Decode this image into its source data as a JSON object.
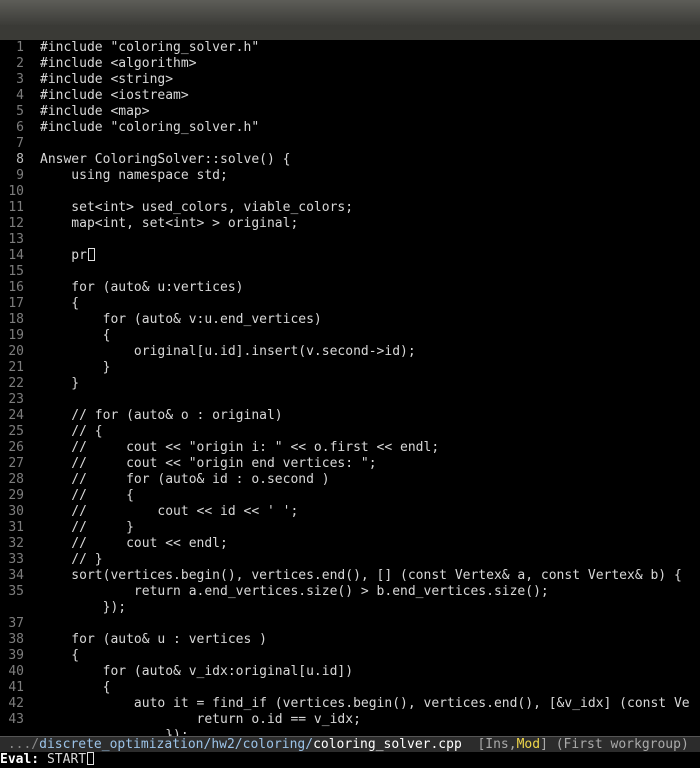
{
  "colors": {
    "background": "#000000",
    "text": "#d8d8d8",
    "line_number": "#7d7d7d",
    "modeline_modified": "#f0d64a",
    "modeline_path": "#9cc3e8"
  },
  "editor": {
    "lines": [
      {
        "num": "1",
        "text": "#include \"coloring_solver.h\""
      },
      {
        "num": "2",
        "text": "#include <algorithm>"
      },
      {
        "num": "3",
        "text": "#include <string>"
      },
      {
        "num": "4",
        "text": "#include <iostream>"
      },
      {
        "num": "5",
        "text": "#include <map>"
      },
      {
        "num": "6",
        "text": "#include \"coloring_solver.h\""
      },
      {
        "num": "7",
        "text": ""
      },
      {
        "num": "8",
        "text": "Answer ColoringSolver::solve() {"
      },
      {
        "num": "9",
        "text": "    using namespace std;"
      },
      {
        "num": "10",
        "text": ""
      },
      {
        "num": "11",
        "text": "    set<int> used_colors, viable_colors;"
      },
      {
        "num": "12",
        "text": "    map<int, set<int> > original;"
      },
      {
        "num": "13",
        "text": ""
      },
      {
        "num": "14",
        "text": "    pr"
      },
      {
        "num": "15",
        "text": ""
      },
      {
        "num": "16",
        "text": "    for (auto& u:vertices)"
      },
      {
        "num": "17",
        "text": "    {"
      },
      {
        "num": "18",
        "text": "        for (auto& v:u.end_vertices)"
      },
      {
        "num": "19",
        "text": "        {"
      },
      {
        "num": "20",
        "text": "            original[u.id].insert(v.second->id);"
      },
      {
        "num": "21",
        "text": "        }"
      },
      {
        "num": "22",
        "text": "    }"
      },
      {
        "num": "23",
        "text": ""
      },
      {
        "num": "24",
        "text": "    // for (auto& o : original)"
      },
      {
        "num": "25",
        "text": "    // {"
      },
      {
        "num": "26",
        "text": "    //     cout << \"origin i: \" << o.first << endl;"
      },
      {
        "num": "27",
        "text": "    //     cout << \"origin end vertices: \";"
      },
      {
        "num": "28",
        "text": "    //     for (auto& id : o.second )"
      },
      {
        "num": "29",
        "text": "    //     {"
      },
      {
        "num": "30",
        "text": "    //         cout << id << ' ';"
      },
      {
        "num": "31",
        "text": "    //     }"
      },
      {
        "num": "32",
        "text": "    //     cout << endl;"
      },
      {
        "num": "33",
        "text": "    // }"
      },
      {
        "num": "34",
        "text": "    sort(vertices.begin(), vertices.end(), [] (const Vertex& a, const Vertex& b) {"
      },
      {
        "num": "35",
        "text": "            return a.end_vertices.size() > b.end_vertices.size();"
      },
      {
        "num": "",
        "text": "        });"
      },
      {
        "num": "37",
        "text": ""
      },
      {
        "num": "38",
        "text": "    for (auto& u : vertices )"
      },
      {
        "num": "39",
        "text": "    {"
      },
      {
        "num": "40",
        "text": "        for (auto& v_idx:original[u.id])"
      },
      {
        "num": "41",
        "text": "        {"
      },
      {
        "num": "42",
        "text": "            auto it = find_if (vertices.begin(), vertices.end(), [&v_idx] (const Ve"
      },
      {
        "num": "43",
        "text": "                    return o.id == v_idx;"
      },
      {
        "num": "",
        "text": "                });"
      }
    ]
  },
  "modeline": {
    "path_prefix": " .../",
    "path_dir": "discrete_optimization/hw2/coloring/",
    "filename": "coloring_solver.cpp",
    "mode_open": "  [Ins,",
    "mode_mod": "Mod",
    "mode_close": "]",
    "workgroup": " (First workgroup)"
  },
  "minibuffer": {
    "label": "Eval:",
    "value": " START"
  }
}
